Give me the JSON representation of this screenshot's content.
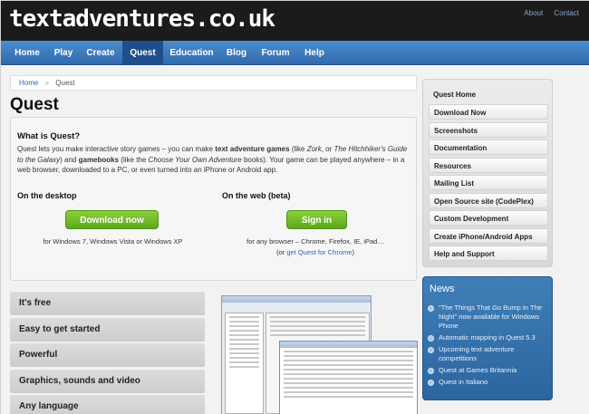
{
  "site": {
    "logo": "textadventures.co.uk",
    "top_links": [
      "About",
      "Contact"
    ]
  },
  "nav": [
    {
      "label": "Home"
    },
    {
      "label": "Play"
    },
    {
      "label": "Create"
    },
    {
      "label": "Quest",
      "active": true
    },
    {
      "label": "Education"
    },
    {
      "label": "Blog"
    },
    {
      "label": "Forum"
    },
    {
      "label": "Help"
    }
  ],
  "breadcrumb": {
    "home": "Home",
    "separator": "»",
    "current": "Quest"
  },
  "page_title": "Quest",
  "what": {
    "heading": "What is Quest?",
    "desc_1": "Quest lets you make interactive story games – you can make ",
    "desc_b1": "text adventure games",
    "desc_2": " (like ",
    "desc_i1": "Zork",
    "desc_3": ", or ",
    "desc_i2": "The Hitchhiker's Guide to the Galaxy",
    "desc_4": ") and ",
    "desc_b2": "gamebooks",
    "desc_5": " (like the ",
    "desc_i3": "Choose Your Own Adventure",
    "desc_6": " books). Your game can be played anywhere – in a web browser, downloaded to a PC, or even turned into an iPhone or Android app.",
    "desktop_heading": "On the desktop",
    "desktop_button": "Download now",
    "desktop_note": "for Windows 7, Windows Vista or Windows XP",
    "web_heading": "On the web (beta)",
    "web_button": "Sign in",
    "web_note": "for any browser – Chrome, Firefox, IE, iPad…",
    "web_note2_pre": "(or ",
    "web_note2_link": "get Quest for Chrome",
    "web_note2_post": ")"
  },
  "features": [
    "It's free",
    "Easy to get started",
    "Powerful",
    "Graphics, sounds and video",
    "Any language"
  ],
  "sidebar": [
    "Quest Home",
    "Download Now",
    "Screenshots",
    "Documentation",
    "Resources",
    "Mailing List",
    "Open Source site (CodePlex)",
    "Custom Development",
    "Create iPhone/Android Apps",
    "Help and Support"
  ],
  "news": {
    "heading": "News",
    "items": [
      "\"The Things That Go Bump In The Night\" now available for Windows Phone",
      "Automatic mapping in Quest 5.3",
      "Upcoming text adventure competitions",
      "Quest at Games Britannia",
      "Quest in Italiano"
    ]
  },
  "colors": {
    "nav_blue": "#3a78bd",
    "nav_active": "#1f4f8a",
    "button_green": "#72bc28",
    "news_blue": "#3470aa"
  }
}
